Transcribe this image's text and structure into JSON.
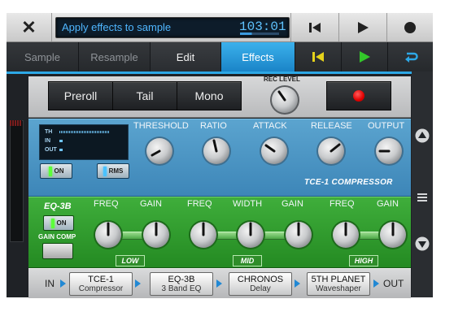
{
  "topbar": {
    "close_icon": "close-icon",
    "title": "Apply effects to sample",
    "time": "103:01",
    "controls": [
      "skip-to-start-icon",
      "play-icon",
      "record-icon"
    ]
  },
  "tabs": [
    {
      "label": "Sample"
    },
    {
      "label": "Resample"
    },
    {
      "label": "Edit"
    },
    {
      "label": "Effects",
      "active": true
    }
  ],
  "tab_icons": [
    "skip-start-yellow-icon",
    "play-green-icon",
    "loop-blue-icon"
  ],
  "recording": {
    "preroll_label": "Preroll",
    "tail_label": "Tail",
    "mono_label": "Mono",
    "rec_level_label": "REC LEVEL"
  },
  "compressor": {
    "display": {
      "th": "TH",
      "in": "IN",
      "out": "OUT"
    },
    "on_label": "ON",
    "rms_label": "RMS",
    "params": [
      {
        "label": "THRESHOLD"
      },
      {
        "label": "RATIO"
      },
      {
        "label": "ATTACK"
      },
      {
        "label": "RELEASE"
      },
      {
        "label": "OUTPUT"
      }
    ],
    "name": "TCE-1 COMPRESSOR"
  },
  "eq": {
    "title": "EQ-3B",
    "on_label": "ON",
    "gain_comp_label": "GAIN COMP",
    "params": [
      {
        "label": "FREQ"
      },
      {
        "label": "GAIN"
      },
      {
        "label": "FREQ"
      },
      {
        "label": "WIDTH"
      },
      {
        "label": "GAIN"
      },
      {
        "label": "FREQ"
      },
      {
        "label": "GAIN"
      }
    ],
    "bands": [
      "LOW",
      "MID",
      "HIGH"
    ]
  },
  "chain": {
    "in_label": "IN",
    "out_label": "OUT",
    "slots": [
      {
        "name": "TCE-1",
        "type": "Compressor"
      },
      {
        "name": "EQ-3B",
        "type": "3 Band EQ"
      },
      {
        "name": "CHRONOS",
        "type": "Delay"
      },
      {
        "name": "5TH PLANET",
        "type": "Waveshaper"
      }
    ]
  },
  "side_icons": [
    "scroll-up-icon",
    "menu-icon",
    "scroll-down-icon"
  ],
  "colors": {
    "accent_blue": "#2da8e6",
    "compressor_blue": "#4f98c6",
    "eq_green": "#2f9c2c",
    "record_red": "#e00000"
  }
}
